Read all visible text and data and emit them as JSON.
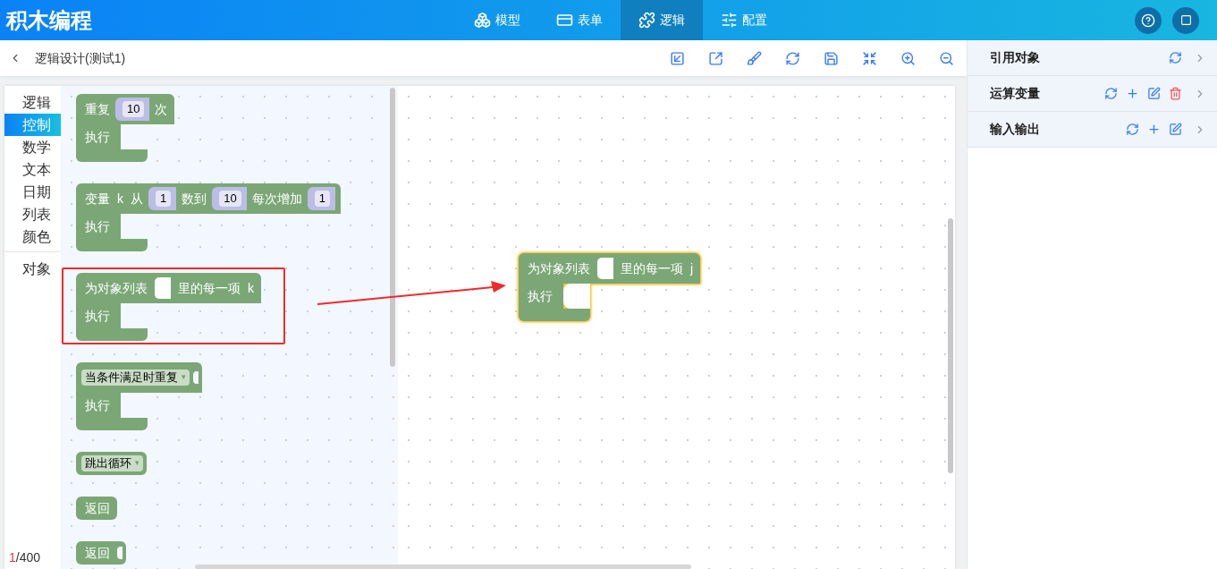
{
  "app": {
    "title": "积木编程"
  },
  "nav_tabs": [
    {
      "label": "模型",
      "selected": false
    },
    {
      "label": "表单",
      "selected": false
    },
    {
      "label": "逻辑",
      "selected": true
    },
    {
      "label": "配置",
      "selected": false
    }
  ],
  "toolbar": {
    "title": "逻辑设计(测试1)"
  },
  "categories": [
    {
      "items": [
        {
          "label": "逻辑",
          "selected": false
        },
        {
          "label": "控制",
          "selected": true
        },
        {
          "label": "数学",
          "selected": false
        },
        {
          "label": "文本",
          "selected": false
        },
        {
          "label": "日期",
          "selected": false
        },
        {
          "label": "列表",
          "selected": false
        },
        {
          "label": "颜色",
          "selected": false
        }
      ]
    },
    {
      "items": [
        {
          "label": "对象",
          "selected": false
        }
      ]
    }
  ],
  "flyout_blocks": [
    {
      "kind": "loop",
      "highlighted": false,
      "tokens": [
        {
          "kind": "text",
          "text": "重复"
        },
        {
          "kind": "number",
          "text": "10"
        },
        {
          "kind": "text",
          "text": "次"
        }
      ],
      "body": "执行"
    },
    {
      "kind": "loop",
      "highlighted": false,
      "tokens": [
        {
          "kind": "text",
          "text": "变量"
        },
        {
          "kind": "text",
          "text": "k"
        },
        {
          "kind": "text",
          "text": "从"
        },
        {
          "kind": "number",
          "text": "1"
        },
        {
          "kind": "text",
          "text": "数到"
        },
        {
          "kind": "number",
          "text": "10"
        },
        {
          "kind": "text",
          "text": "每次增加"
        },
        {
          "kind": "number",
          "text": "1"
        }
      ],
      "body": "执行"
    },
    {
      "kind": "loop",
      "highlighted": true,
      "tokens": [
        {
          "kind": "text",
          "text": "为对象列表"
        },
        {
          "kind": "socket"
        },
        {
          "kind": "text",
          "text": "里的每一项"
        },
        {
          "kind": "text",
          "text": "k"
        }
      ],
      "body": "执行"
    },
    {
      "kind": "loop",
      "highlighted": false,
      "tokens": [
        {
          "kind": "dropdown",
          "text": "当条件满足时重复",
          "caret": "▾"
        },
        {
          "kind": "notch"
        }
      ],
      "body": "执行"
    },
    {
      "kind": "simple",
      "highlighted": false,
      "tokens": [
        {
          "kind": "dropdown",
          "text": "跳出循环",
          "caret": "▾"
        }
      ]
    },
    {
      "kind": "simple",
      "highlighted": false,
      "tokens": [
        {
          "kind": "text",
          "text": "返回"
        }
      ]
    },
    {
      "kind": "simple",
      "highlighted": false,
      "tokens": [
        {
          "kind": "text",
          "text": "返回"
        },
        {
          "kind": "notch"
        }
      ]
    }
  ],
  "workspace_block": {
    "kind": "loop",
    "selected": true,
    "tokens": [
      {
        "kind": "text",
        "text": "为对象列表"
      },
      {
        "kind": "socket"
      },
      {
        "kind": "text",
        "text": "里的每一项"
      },
      {
        "kind": "text",
        "text": "j"
      }
    ],
    "body": "执行"
  },
  "counter": {
    "current": "1",
    "rest": "/400"
  },
  "side_panel": [
    {
      "title": "引用对象",
      "actions": [
        {
          "kind": "refresh"
        }
      ]
    },
    {
      "title": "运算变量",
      "actions": [
        {
          "kind": "refresh"
        },
        {
          "kind": "add"
        },
        {
          "kind": "edit"
        },
        {
          "kind": "delete"
        }
      ]
    },
    {
      "title": "输入输出",
      "actions": [
        {
          "kind": "refresh"
        },
        {
          "kind": "add"
        },
        {
          "kind": "edit"
        }
      ]
    }
  ]
}
